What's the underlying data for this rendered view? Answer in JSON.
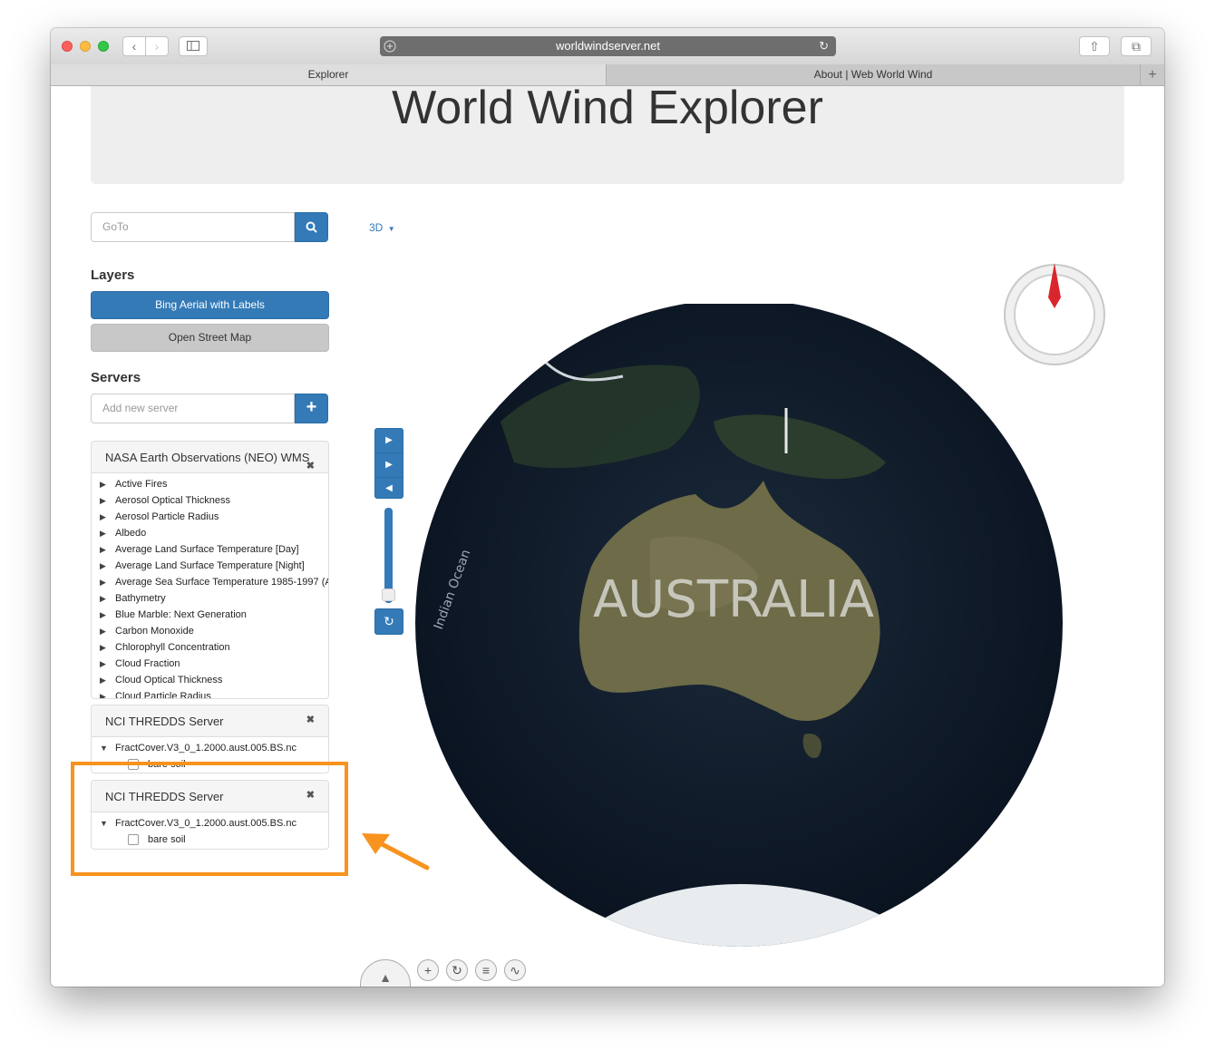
{
  "browser": {
    "url": "worldwindserver.net",
    "tabs": [
      {
        "label": "Explorer",
        "active": true
      },
      {
        "label": "About | Web World Wind",
        "active": false
      }
    ]
  },
  "page": {
    "title": "World Wind Explorer"
  },
  "goto": {
    "placeholder": "GoTo"
  },
  "projection": {
    "label": "3D"
  },
  "layers": {
    "heading": "Layers",
    "items": [
      {
        "label": "Bing Aerial with Labels",
        "enabled": true
      },
      {
        "label": "Open Street Map",
        "enabled": false
      }
    ]
  },
  "servers": {
    "heading": "Servers",
    "add_placeholder": "Add new server",
    "panels": [
      {
        "title": "NASA Earth Observations (NEO) WMS",
        "items": [
          "Active Fires",
          "Aerosol Optical Thickness",
          "Aerosol Particle Radius",
          "Albedo",
          "Average Land Surface Temperature [Day]",
          "Average Land Surface Temperature [Night]",
          "Average Sea Surface Temperature 1985-1997 (A'",
          "Bathymetry",
          "Blue Marble: Next Generation",
          "Carbon Monoxide",
          "Chlorophyll Concentration",
          "Cloud Fraction",
          "Cloud Optical Thickness",
          "Cloud Particle Radius"
        ]
      },
      {
        "title": "NCI THREDDS Server",
        "dataset": "FractCover.V3_0_1.2000.aust.005.BS.nc",
        "layer": "bare soil"
      },
      {
        "title": "NCI THREDDS Server",
        "dataset": "FractCover.V3_0_1.2000.aust.005.BS.nc",
        "layer": "bare soil"
      }
    ]
  },
  "globe": {
    "labels": {
      "continent": "AUSTRALIA",
      "ocean": "Indian Ocean"
    }
  },
  "colors": {
    "primary": "#337ab7",
    "highlight": "#f7931e",
    "compass_needle": "#d9262c"
  },
  "icons": [
    "search-icon",
    "plus-icon",
    "close-icon",
    "step-forward-icon",
    "play-icon",
    "step-back-icon",
    "refresh-icon",
    "compass-icon",
    "pan-icon",
    "zoom-icon",
    "rotate-icon",
    "tilt-icon",
    "exaggeration-icon"
  ]
}
